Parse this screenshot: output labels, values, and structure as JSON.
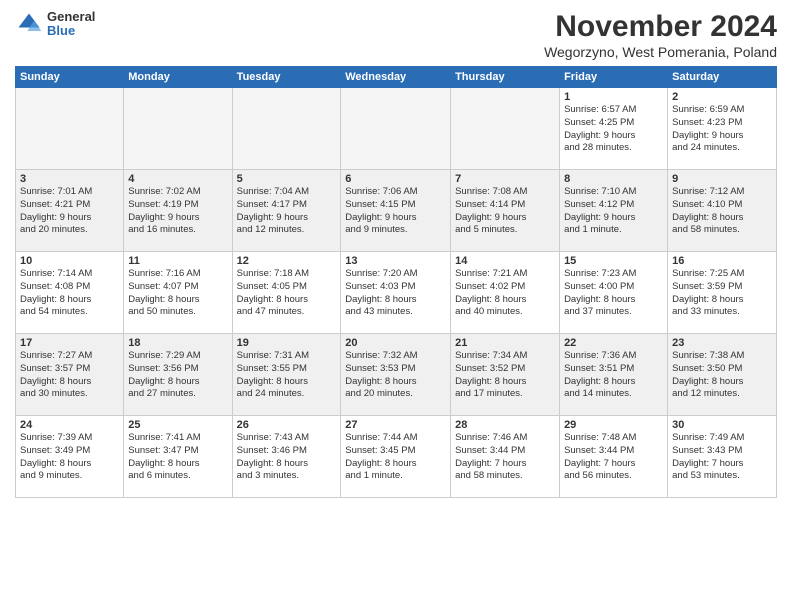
{
  "header": {
    "logo_general": "General",
    "logo_blue": "Blue",
    "month_title": "November 2024",
    "location": "Wegorzyno, West Pomerania, Poland"
  },
  "weekdays": [
    "Sunday",
    "Monday",
    "Tuesday",
    "Wednesday",
    "Thursday",
    "Friday",
    "Saturday"
  ],
  "weeks": [
    [
      {
        "day": "",
        "info": ""
      },
      {
        "day": "",
        "info": ""
      },
      {
        "day": "",
        "info": ""
      },
      {
        "day": "",
        "info": ""
      },
      {
        "day": "",
        "info": ""
      },
      {
        "day": "1",
        "info": "Sunrise: 6:57 AM\nSunset: 4:25 PM\nDaylight: 9 hours\nand 28 minutes."
      },
      {
        "day": "2",
        "info": "Sunrise: 6:59 AM\nSunset: 4:23 PM\nDaylight: 9 hours\nand 24 minutes."
      }
    ],
    [
      {
        "day": "3",
        "info": "Sunrise: 7:01 AM\nSunset: 4:21 PM\nDaylight: 9 hours\nand 20 minutes."
      },
      {
        "day": "4",
        "info": "Sunrise: 7:02 AM\nSunset: 4:19 PM\nDaylight: 9 hours\nand 16 minutes."
      },
      {
        "day": "5",
        "info": "Sunrise: 7:04 AM\nSunset: 4:17 PM\nDaylight: 9 hours\nand 12 minutes."
      },
      {
        "day": "6",
        "info": "Sunrise: 7:06 AM\nSunset: 4:15 PM\nDaylight: 9 hours\nand 9 minutes."
      },
      {
        "day": "7",
        "info": "Sunrise: 7:08 AM\nSunset: 4:14 PM\nDaylight: 9 hours\nand 5 minutes."
      },
      {
        "day": "8",
        "info": "Sunrise: 7:10 AM\nSunset: 4:12 PM\nDaylight: 9 hours\nand 1 minute."
      },
      {
        "day": "9",
        "info": "Sunrise: 7:12 AM\nSunset: 4:10 PM\nDaylight: 8 hours\nand 58 minutes."
      }
    ],
    [
      {
        "day": "10",
        "info": "Sunrise: 7:14 AM\nSunset: 4:08 PM\nDaylight: 8 hours\nand 54 minutes."
      },
      {
        "day": "11",
        "info": "Sunrise: 7:16 AM\nSunset: 4:07 PM\nDaylight: 8 hours\nand 50 minutes."
      },
      {
        "day": "12",
        "info": "Sunrise: 7:18 AM\nSunset: 4:05 PM\nDaylight: 8 hours\nand 47 minutes."
      },
      {
        "day": "13",
        "info": "Sunrise: 7:20 AM\nSunset: 4:03 PM\nDaylight: 8 hours\nand 43 minutes."
      },
      {
        "day": "14",
        "info": "Sunrise: 7:21 AM\nSunset: 4:02 PM\nDaylight: 8 hours\nand 40 minutes."
      },
      {
        "day": "15",
        "info": "Sunrise: 7:23 AM\nSunset: 4:00 PM\nDaylight: 8 hours\nand 37 minutes."
      },
      {
        "day": "16",
        "info": "Sunrise: 7:25 AM\nSunset: 3:59 PM\nDaylight: 8 hours\nand 33 minutes."
      }
    ],
    [
      {
        "day": "17",
        "info": "Sunrise: 7:27 AM\nSunset: 3:57 PM\nDaylight: 8 hours\nand 30 minutes."
      },
      {
        "day": "18",
        "info": "Sunrise: 7:29 AM\nSunset: 3:56 PM\nDaylight: 8 hours\nand 27 minutes."
      },
      {
        "day": "19",
        "info": "Sunrise: 7:31 AM\nSunset: 3:55 PM\nDaylight: 8 hours\nand 24 minutes."
      },
      {
        "day": "20",
        "info": "Sunrise: 7:32 AM\nSunset: 3:53 PM\nDaylight: 8 hours\nand 20 minutes."
      },
      {
        "day": "21",
        "info": "Sunrise: 7:34 AM\nSunset: 3:52 PM\nDaylight: 8 hours\nand 17 minutes."
      },
      {
        "day": "22",
        "info": "Sunrise: 7:36 AM\nSunset: 3:51 PM\nDaylight: 8 hours\nand 14 minutes."
      },
      {
        "day": "23",
        "info": "Sunrise: 7:38 AM\nSunset: 3:50 PM\nDaylight: 8 hours\nand 12 minutes."
      }
    ],
    [
      {
        "day": "24",
        "info": "Sunrise: 7:39 AM\nSunset: 3:49 PM\nDaylight: 8 hours\nand 9 minutes."
      },
      {
        "day": "25",
        "info": "Sunrise: 7:41 AM\nSunset: 3:47 PM\nDaylight: 8 hours\nand 6 minutes."
      },
      {
        "day": "26",
        "info": "Sunrise: 7:43 AM\nSunset: 3:46 PM\nDaylight: 8 hours\nand 3 minutes."
      },
      {
        "day": "27",
        "info": "Sunrise: 7:44 AM\nSunset: 3:45 PM\nDaylight: 8 hours\nand 1 minute."
      },
      {
        "day": "28",
        "info": "Sunrise: 7:46 AM\nSunset: 3:44 PM\nDaylight: 7 hours\nand 58 minutes."
      },
      {
        "day": "29",
        "info": "Sunrise: 7:48 AM\nSunset: 3:44 PM\nDaylight: 7 hours\nand 56 minutes."
      },
      {
        "day": "30",
        "info": "Sunrise: 7:49 AM\nSunset: 3:43 PM\nDaylight: 7 hours\nand 53 minutes."
      }
    ]
  ]
}
